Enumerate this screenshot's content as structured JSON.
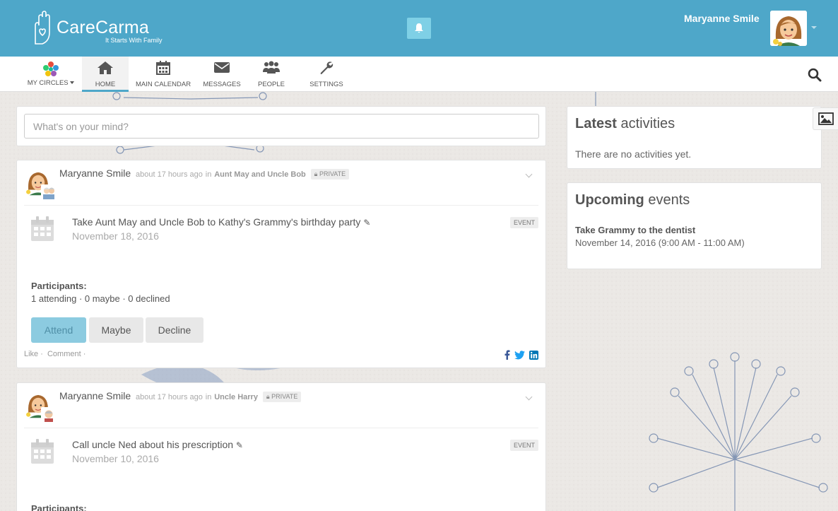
{
  "brand": {
    "name": "CareCarma",
    "tagline": "It Starts With Family",
    "colors": {
      "primary": "#4ea7c9",
      "bell": "#7fd0e6",
      "attend": "#8ccbe0"
    }
  },
  "header": {
    "user_name": "Maryanne Smile",
    "notification_icon": "bell-icon"
  },
  "nav": {
    "my_circles": "MY CIRCLES",
    "items": [
      {
        "label": "HOME",
        "icon": "home-icon",
        "active": true
      },
      {
        "label": "MAIN CALENDAR",
        "icon": "calendar-icon"
      },
      {
        "label": "MESSAGES",
        "icon": "envelope-icon"
      },
      {
        "label": "PEOPLE",
        "icon": "people-icon"
      },
      {
        "label": "SETTINGS",
        "icon": "wrench-icon"
      }
    ],
    "search_icon": "search-icon"
  },
  "composer": {
    "placeholder": "What's on your mind?"
  },
  "posts": [
    {
      "author": "Maryanne Smile",
      "time": "about 17 hours ago",
      "in": "in",
      "circle": "Aunt May and Uncle Bob",
      "privacy": "PRIVATE",
      "event_title": "Take Aunt May and Uncle Bob to Kathy's Grammy's birthday party",
      "event_date": "November 18, 2016",
      "badge": "EVENT",
      "participants_label": "Participants:",
      "participants_counts": "1 attending · 0 maybe · 0 declined",
      "buttons": {
        "attend": "Attend",
        "maybe": "Maybe",
        "decline": "Decline"
      },
      "like": "Like ·",
      "comment": "Comment ·"
    },
    {
      "author": "Maryanne Smile",
      "time": "about 17 hours ago",
      "in": "in",
      "circle": "Uncle Harry",
      "privacy": "PRIVATE",
      "event_title": "Call uncle Ned about his prescription",
      "event_date": "November 10, 2016",
      "badge": "EVENT",
      "participants_label": "Participants:"
    }
  ],
  "sidebar": {
    "latest": {
      "title_bold": "Latest",
      "title_rest": "activities",
      "empty": "There are no activities yet."
    },
    "upcoming": {
      "title_bold": "Upcoming",
      "title_rest": "events",
      "event_title": "Take Grammy to the dentist",
      "event_date": "November 14, 2016 (9:00 AM - 11:00 AM)"
    }
  }
}
